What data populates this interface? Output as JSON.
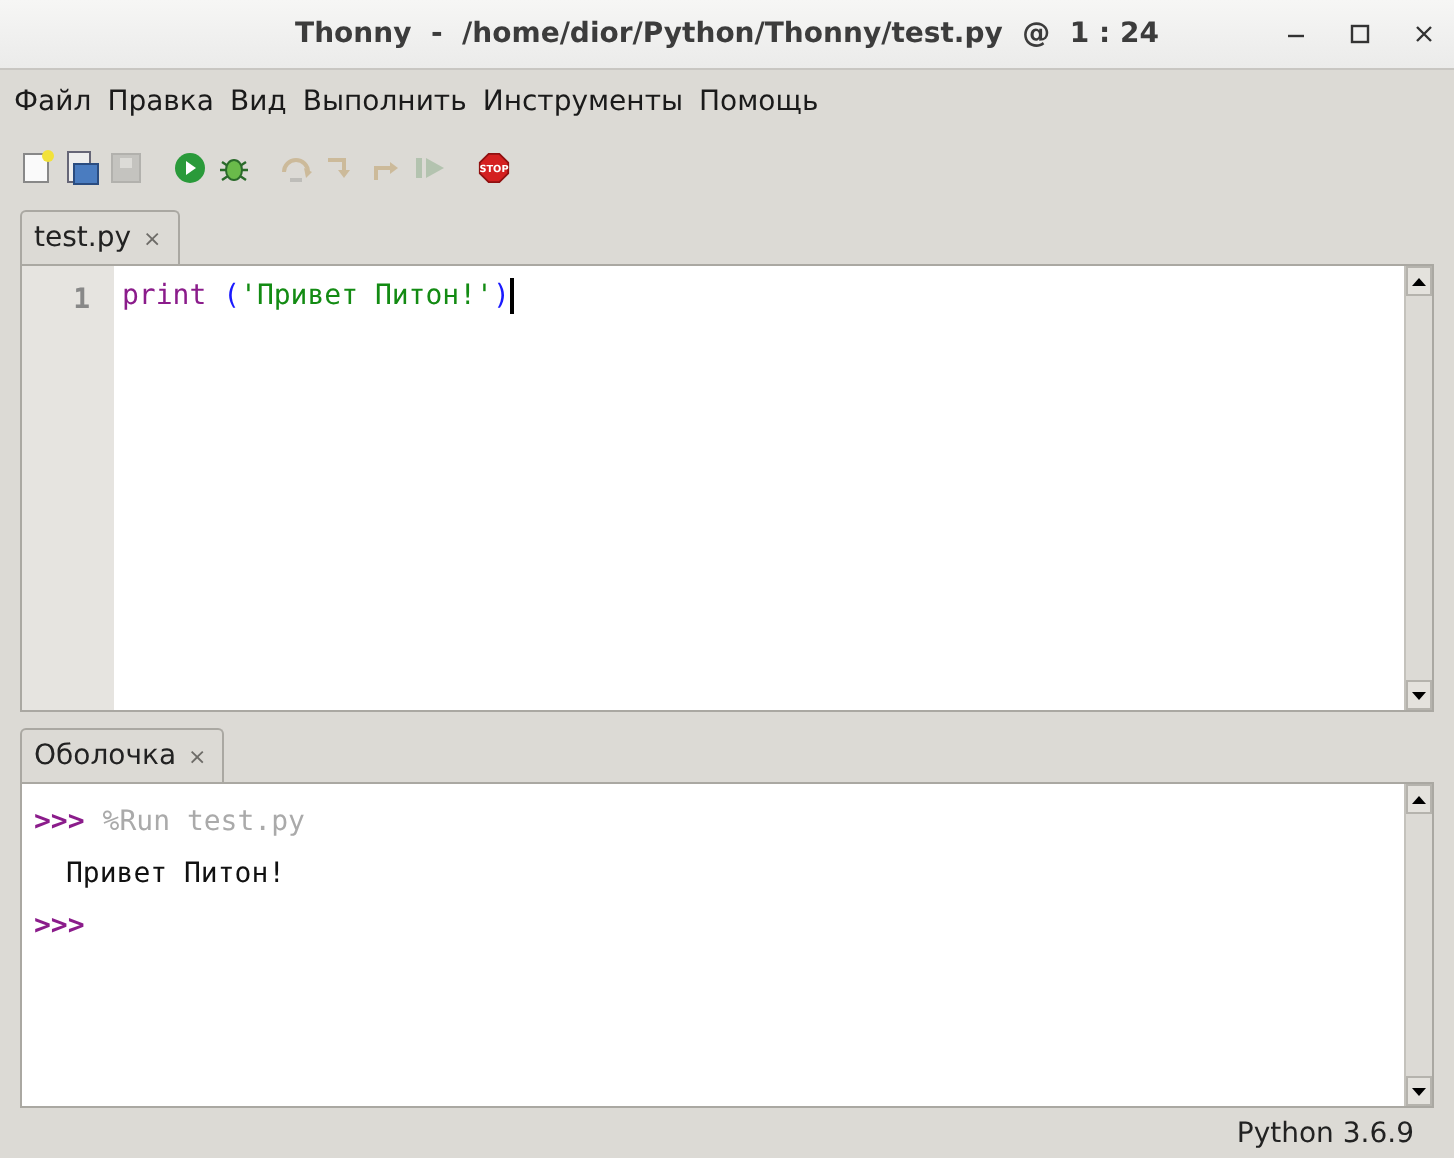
{
  "window": {
    "title": "Thonny  -  /home/dior/Python/Thonny/test.py  @  1 : 24"
  },
  "menu": [
    "Файл",
    "Правка",
    "Вид",
    "Выполнить",
    "Инструменты",
    "Помощь"
  ],
  "toolbar": [
    [
      {
        "kind": "new",
        "disabled": false
      },
      {
        "kind": "open",
        "disabled": false
      },
      {
        "kind": "save",
        "disabled": true
      }
    ],
    [
      {
        "kind": "run",
        "disabled": false
      },
      {
        "kind": "debug",
        "disabled": false
      }
    ],
    [
      {
        "kind": "step_over",
        "disabled": true
      },
      {
        "kind": "step_into",
        "disabled": true
      },
      {
        "kind": "step_out",
        "disabled": true
      },
      {
        "kind": "resume",
        "disabled": true
      }
    ],
    [
      {
        "kind": "stop",
        "disabled": false,
        "label": "STOP"
      }
    ]
  ],
  "editor": {
    "tab": {
      "label": "test.py",
      "close": "×",
      "selected": true
    },
    "lines": [
      {
        "number": "1",
        "tokens": [
          {
            "kind": "builtin",
            "text": "print"
          },
          {
            "kind": "paren",
            "text": "("
          },
          {
            "kind": "string",
            "text": "'Привет Питон!'"
          },
          {
            "kind": "paren",
            "text": ")"
          }
        ]
      }
    ]
  },
  "shell": {
    "tab": {
      "label": "Оболочка",
      "close": "×",
      "selected": true
    },
    "lines": [
      {
        "kind": "command",
        "prompt": ">>>",
        "text": "%Run test.py"
      },
      {
        "kind": "output",
        "text": "Привет Питон!"
      },
      {
        "kind": "command",
        "prompt": ">>>"
      }
    ]
  },
  "status_bar": {
    "version": "Python 3.6.9"
  }
}
